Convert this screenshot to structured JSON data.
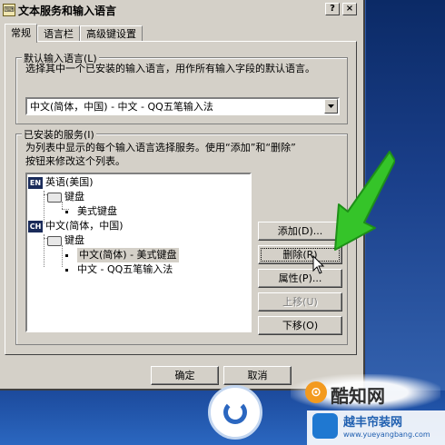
{
  "window": {
    "title": "文本服务和输入语言",
    "help_glyph": "?",
    "close_glyph": "×",
    "icon": "keyboard-app-icon"
  },
  "tabs": [
    {
      "label": "常规",
      "active": true
    },
    {
      "label": "语言栏",
      "active": false
    },
    {
      "label": "高级键设置",
      "active": false
    }
  ],
  "default_language": {
    "group_label": "默认输入语言(L)",
    "description": "选择其中一个已安装的输入语言，用作所有输入字段的默认语言。",
    "selected_value": "中文(简体，中国) - 中文 - QQ五笔输入法"
  },
  "installed_services": {
    "group_label": "已安装的服务(I)",
    "description_line1": "为列表中显示的每个输入语言选择服务。使用“添加”和“删除”",
    "description_line2": "按钮来修改这个列表。",
    "tree": [
      {
        "type": "language",
        "badge": "EN",
        "label": "英语(美国)"
      },
      {
        "type": "category",
        "label": "键盘"
      },
      {
        "type": "service",
        "label": "美式键盘"
      },
      {
        "type": "language",
        "badge": "CH",
        "label": "中文(简体，中国)"
      },
      {
        "type": "category",
        "label": "键盘"
      },
      {
        "type": "service",
        "label": "中文(简体) - 美式键盘",
        "selected": true
      },
      {
        "type": "service",
        "label": "中文 - QQ五笔输入法"
      }
    ],
    "buttons": {
      "add": "添加(D)...",
      "remove": "删除(R)",
      "properties": "属性(P)...",
      "move_up": "上移(U)",
      "move_down": "下移(O)"
    }
  },
  "footer": {
    "ok": "确定",
    "cancel": "取消"
  },
  "watermark": {
    "logo_glyph": "⊙",
    "site_name": "酷知网",
    "brand": "越丰帘装网",
    "url": "www.yueyangbang.com"
  },
  "colors": {
    "arrow": "#35c429",
    "tree_badge_bg": "#1a2b5a",
    "window_bg": "#d4d0c8",
    "desktop": "#2b57a8"
  }
}
